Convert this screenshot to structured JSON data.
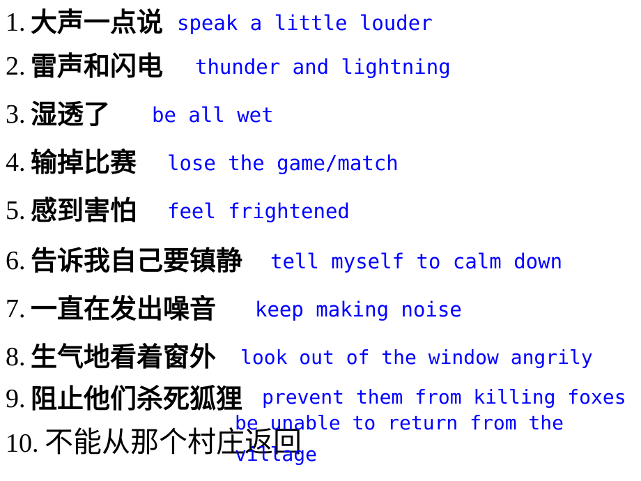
{
  "slide": {
    "background_color": "#ffffff",
    "chinese_color": "#000000",
    "english_color": "#0000ff",
    "items": [
      {
        "number": "1.",
        "chinese": "大声一点说",
        "english": "speak a little louder"
      },
      {
        "number": "2.",
        "chinese": "雷声和闪电",
        "english": "thunder and lightning"
      },
      {
        "number": "3.",
        "chinese": "湿透了",
        "english": "be all wet"
      },
      {
        "number": "4.",
        "chinese": "输掉比赛",
        "english": "lose the game/match"
      },
      {
        "number": "5.",
        "chinese": "感到害怕",
        "english": "feel frightened"
      },
      {
        "number": "6.",
        "chinese": "告诉我自己要镇静",
        "english": "tell myself to calm down"
      },
      {
        "number": "7.",
        "chinese": "一直在发出噪音",
        "english": "keep making noise"
      },
      {
        "number": "8.",
        "chinese": "生气地看着窗外",
        "english": "look out of the window angrily"
      },
      {
        "number": "9.",
        "chinese": "阻止他们杀死狐狸",
        "english": "prevent them from killing foxes"
      },
      {
        "number": "10.",
        "chinese": "不能从那个村庄返回",
        "english_line1": "be unable to return from the",
        "english_line2": "village"
      }
    ]
  }
}
